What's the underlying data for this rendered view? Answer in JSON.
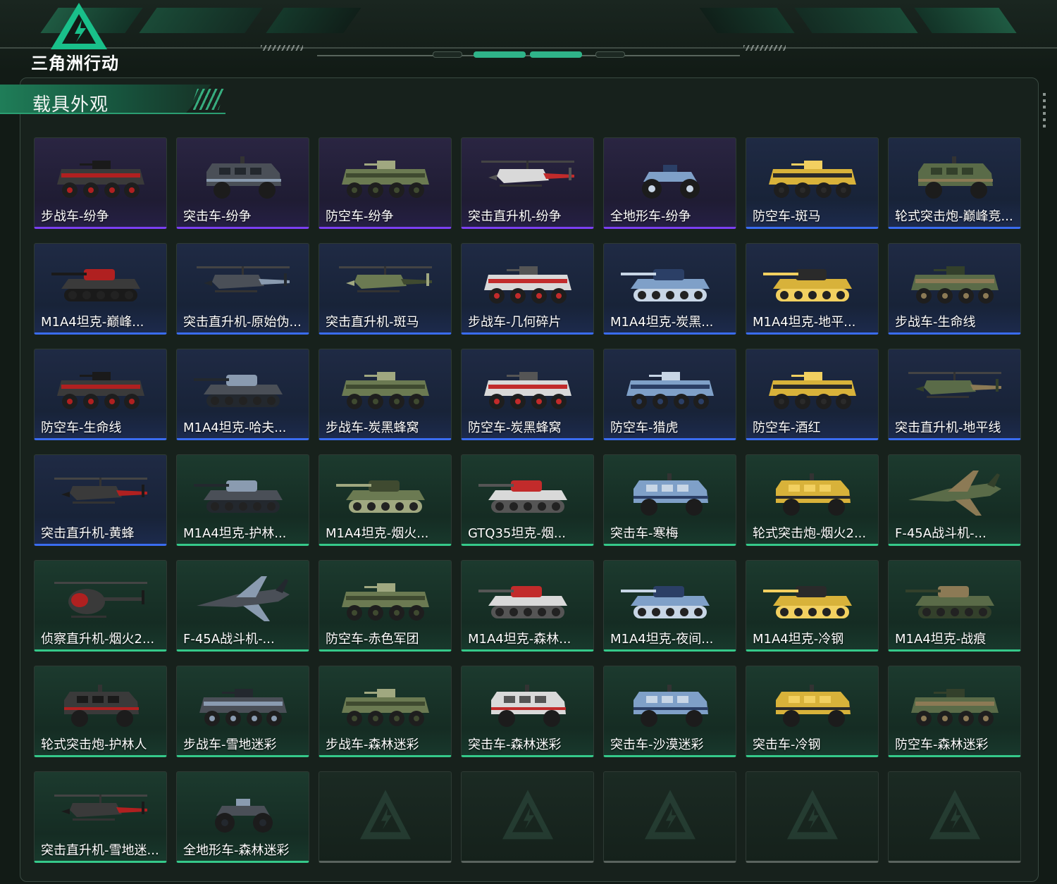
{
  "app": {
    "logo_text": "三角洲行动"
  },
  "section": {
    "title": "载具外观"
  },
  "colors": {
    "purple": "#7b3ff2",
    "blue": "#3a6cf0",
    "green": "#35c98a",
    "accent": "#2fb489"
  },
  "items": [
    {
      "label": "步战车-纷争",
      "rarity": "purple",
      "icon": "ifv-icon"
    },
    {
      "label": "突击车-纷争",
      "rarity": "purple",
      "icon": "assault-vehicle-icon"
    },
    {
      "label": "防空车-纷争",
      "rarity": "purple",
      "icon": "aa-vehicle-icon"
    },
    {
      "label": "突击直升机-纷争",
      "rarity": "purple",
      "icon": "helicopter-icon"
    },
    {
      "label": "全地形车-纷争",
      "rarity": "purple",
      "icon": "atv-icon"
    },
    {
      "label": "防空车-斑马",
      "rarity": "blue",
      "icon": "aa-vehicle-icon"
    },
    {
      "label": "轮式突击炮-巅峰竞...",
      "rarity": "blue",
      "icon": "wheeled-assault-gun-icon"
    },
    {
      "label": "M1A4坦克-巅峰...",
      "rarity": "blue",
      "icon": "tank-icon"
    },
    {
      "label": "突击直升机-原始伪...",
      "rarity": "blue",
      "icon": "helicopter-icon"
    },
    {
      "label": "突击直升机-斑马",
      "rarity": "blue",
      "icon": "helicopter-icon"
    },
    {
      "label": "步战车-几何碎片",
      "rarity": "blue",
      "icon": "ifv-icon"
    },
    {
      "label": "M1A4坦克-炭黑...",
      "rarity": "blue",
      "icon": "tank-icon"
    },
    {
      "label": "M1A4坦克-地平...",
      "rarity": "blue",
      "icon": "tank-icon"
    },
    {
      "label": "步战车-生命线",
      "rarity": "blue",
      "icon": "ifv-icon"
    },
    {
      "label": "防空车-生命线",
      "rarity": "blue",
      "icon": "aa-vehicle-icon"
    },
    {
      "label": "M1A4坦克-哈夫...",
      "rarity": "blue",
      "icon": "tank-icon"
    },
    {
      "label": "步战车-炭黑蜂窝",
      "rarity": "blue",
      "icon": "ifv-icon"
    },
    {
      "label": "防空车-炭黑蜂窝",
      "rarity": "blue",
      "icon": "aa-vehicle-icon"
    },
    {
      "label": "防空车-猎虎",
      "rarity": "blue",
      "icon": "aa-vehicle-icon"
    },
    {
      "label": "防空车-酒红",
      "rarity": "blue",
      "icon": "aa-vehicle-icon"
    },
    {
      "label": "突击直升机-地平线",
      "rarity": "blue",
      "icon": "helicopter-icon"
    },
    {
      "label": "突击直升机-黄蜂",
      "rarity": "blue",
      "icon": "helicopter-icon"
    },
    {
      "label": "M1A4坦克-护林...",
      "rarity": "green",
      "icon": "tank-icon"
    },
    {
      "label": "M1A4坦克-烟火...",
      "rarity": "green",
      "icon": "tank-icon"
    },
    {
      "label": "GTQ35坦克-烟...",
      "rarity": "green",
      "icon": "tank-icon"
    },
    {
      "label": "突击车-寒梅",
      "rarity": "green",
      "icon": "assault-vehicle-icon"
    },
    {
      "label": "轮式突击炮-烟火2...",
      "rarity": "green",
      "icon": "wheeled-assault-gun-icon"
    },
    {
      "label": "F-45A战斗机-...",
      "rarity": "green",
      "icon": "fighter-jet-icon"
    },
    {
      "label": "侦察直升机-烟火2...",
      "rarity": "green",
      "icon": "scout-helicopter-icon"
    },
    {
      "label": "F-45A战斗机-...",
      "rarity": "green",
      "icon": "fighter-jet-icon"
    },
    {
      "label": "防空车-赤色军团",
      "rarity": "green",
      "icon": "aa-vehicle-icon"
    },
    {
      "label": "M1A4坦克-森林...",
      "rarity": "green",
      "icon": "tank-icon"
    },
    {
      "label": "M1A4坦克-夜间...",
      "rarity": "green",
      "icon": "tank-icon"
    },
    {
      "label": "M1A4坦克-冷钢",
      "rarity": "green",
      "icon": "tank-icon"
    },
    {
      "label": "M1A4坦克-战痕",
      "rarity": "green",
      "icon": "tank-icon"
    },
    {
      "label": "轮式突击炮-护林人",
      "rarity": "green",
      "icon": "wheeled-assault-gun-icon"
    },
    {
      "label": "步战车-雪地迷彩",
      "rarity": "green",
      "icon": "ifv-icon"
    },
    {
      "label": "步战车-森林迷彩",
      "rarity": "green",
      "icon": "ifv-icon"
    },
    {
      "label": "突击车-森林迷彩",
      "rarity": "green",
      "icon": "assault-vehicle-icon"
    },
    {
      "label": "突击车-沙漠迷彩",
      "rarity": "green",
      "icon": "assault-vehicle-icon"
    },
    {
      "label": "突击车-冷钢",
      "rarity": "green",
      "icon": "assault-vehicle-icon"
    },
    {
      "label": "防空车-森林迷彩",
      "rarity": "green",
      "icon": "aa-vehicle-icon"
    },
    {
      "label": "突击直升机-雪地迷...",
      "rarity": "green",
      "icon": "helicopter-icon"
    },
    {
      "label": "全地形车-森林迷彩",
      "rarity": "green",
      "icon": "atv-icon"
    },
    {
      "label": "",
      "rarity": "empty",
      "icon": "empty-slot-icon"
    },
    {
      "label": "",
      "rarity": "empty",
      "icon": "empty-slot-icon"
    },
    {
      "label": "",
      "rarity": "empty",
      "icon": "empty-slot-icon"
    },
    {
      "label": "",
      "rarity": "empty",
      "icon": "empty-slot-icon"
    },
    {
      "label": "",
      "rarity": "empty",
      "icon": "empty-slot-icon"
    }
  ]
}
